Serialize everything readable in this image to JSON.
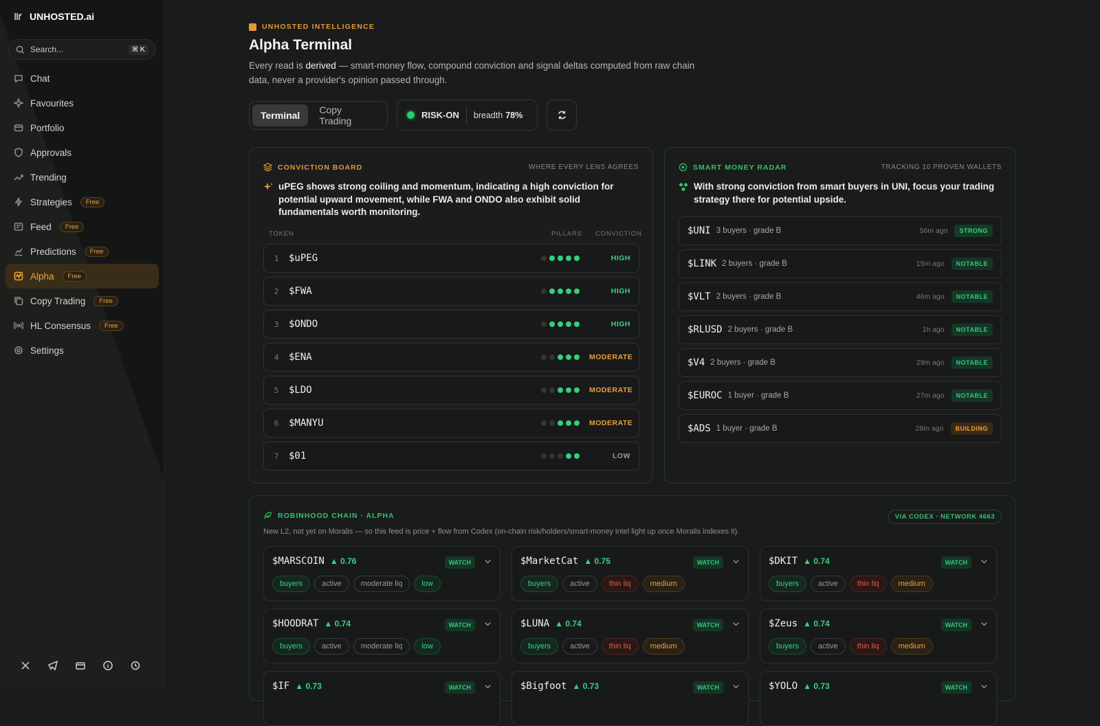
{
  "brand": {
    "name": "UNHOSTED.ai"
  },
  "search": {
    "placeholder": "Search...",
    "shortcut": "⌘ K"
  },
  "nav": [
    {
      "label": "Chat",
      "icon": "chat-icon"
    },
    {
      "label": "Favourites",
      "icon": "sparkle-icon"
    },
    {
      "label": "Portfolio",
      "icon": "wallet-icon"
    },
    {
      "label": "Approvals",
      "icon": "shield-icon"
    },
    {
      "label": "Trending",
      "icon": "trending-icon"
    },
    {
      "label": "Strategies",
      "icon": "bolt-icon",
      "badge": "Free"
    },
    {
      "label": "Feed",
      "icon": "feed-icon",
      "badge": "Free"
    },
    {
      "label": "Predictions",
      "icon": "chart-icon",
      "badge": "Free"
    },
    {
      "label": "Alpha",
      "icon": "alpha-icon",
      "badge": "Free",
      "active": true
    },
    {
      "label": "Copy Trading",
      "icon": "copy-icon",
      "badge": "Free"
    },
    {
      "label": "HL Consensus",
      "icon": "radio-icon",
      "badge": "Free"
    },
    {
      "label": "Settings",
      "icon": "gear-icon"
    }
  ],
  "footer_icons": [
    "x-icon",
    "telegram-icon",
    "wallet-icon",
    "info-icon",
    "history-icon"
  ],
  "header": {
    "eyebrow": "UNHOSTED INTELLIGENCE",
    "title": "Alpha Terminal",
    "sub_pre": "Every read is ",
    "sub_bold": "derived",
    "sub_post": " — smart-money flow, compound conviction and signal deltas computed from raw chain data, never a provider's opinion passed through."
  },
  "tabs": [
    "Terminal",
    "Copy Trading"
  ],
  "regime": {
    "label": "RISK-ON",
    "breadth_label": "breadth",
    "breadth_value": "78%"
  },
  "conviction": {
    "title": "CONVICTION BOARD",
    "right": "WHERE EVERY LENS AGREES",
    "summary": "uPEG shows strong coiling and momentum, indicating a high conviction for potential upward movement, while FWA and ONDO also exhibit solid fundamentals worth monitoring.",
    "col_token": "TOKEN",
    "col_pillars": "PILLARS",
    "col_conviction": "CONVICTION",
    "rows": [
      {
        "rank": "1",
        "token": "$uPEG",
        "pillars": 4,
        "level": "HIGH"
      },
      {
        "rank": "2",
        "token": "$FWA",
        "pillars": 4,
        "level": "HIGH"
      },
      {
        "rank": "3",
        "token": "$ONDO",
        "pillars": 4,
        "level": "HIGH"
      },
      {
        "rank": "4",
        "token": "$ENA",
        "pillars": 3,
        "level": "MODERATE"
      },
      {
        "rank": "5",
        "token": "$LDO",
        "pillars": 3,
        "level": "MODERATE"
      },
      {
        "rank": "6",
        "token": "$MANYU",
        "pillars": 3,
        "level": "MODERATE"
      },
      {
        "rank": "7",
        "token": "$01",
        "pillars": 2,
        "level": "LOW"
      }
    ],
    "pillar_total": 5
  },
  "radar": {
    "title": "SMART MONEY RADAR",
    "right": "TRACKING 10 PROVEN WALLETS",
    "summary": "With strong conviction from smart buyers in UNI, focus your trading strategy there for potential upside.",
    "rows": [
      {
        "token": "$UNI",
        "meta": "3 buyers · grade B",
        "ago": "56m ago",
        "tag": "STRONG"
      },
      {
        "token": "$LINK",
        "meta": "2 buyers · grade B",
        "ago": "15m ago",
        "tag": "NOTABLE"
      },
      {
        "token": "$VLT",
        "meta": "2 buyers · grade B",
        "ago": "46m ago",
        "tag": "NOTABLE"
      },
      {
        "token": "$RLUSD",
        "meta": "2 buyers · grade B",
        "ago": "1h ago",
        "tag": "NOTABLE"
      },
      {
        "token": "$V4",
        "meta": "2 buyers · grade B",
        "ago": "29m ago",
        "tag": "NOTABLE"
      },
      {
        "token": "$EUROC",
        "meta": "1 buyer · grade B",
        "ago": "27m ago",
        "tag": "NOTABLE"
      },
      {
        "token": "$ADS",
        "meta": "1 buyer · grade B",
        "ago": "28m ago",
        "tag": "BUILDING"
      }
    ]
  },
  "chain": {
    "title": "ROBINHOOD CHAIN · ALPHA",
    "via": "VIA CODEX · NETWORK 4663",
    "sub": "New L2, not yet on Moralis — so this feed is price + flow from Codex (on-chain risk/holders/smart-money intel light up once Moralis indexes it).",
    "cards": [
      {
        "token": "$MARSCOIN",
        "score": "▲ 0.76",
        "action": "WATCH",
        "chips": [
          [
            "buyers",
            "g"
          ],
          [
            "active",
            ""
          ],
          [
            "moderate liq",
            ""
          ],
          [
            "low",
            "g"
          ]
        ]
      },
      {
        "token": "$MarketCat",
        "score": "▲ 0.75",
        "action": "WATCH",
        "chips": [
          [
            "buyers",
            "g"
          ],
          [
            "active",
            ""
          ],
          [
            "thin liq",
            "r"
          ],
          [
            "medium",
            "o"
          ]
        ]
      },
      {
        "token": "$DKIT",
        "score": "▲ 0.74",
        "action": "WATCH",
        "chips": [
          [
            "buyers",
            "g"
          ],
          [
            "active",
            ""
          ],
          [
            "thin liq",
            "r"
          ],
          [
            "medium",
            "o"
          ]
        ]
      },
      {
        "token": "$HOODRAT",
        "score": "▲ 0.74",
        "action": "WATCH",
        "chips": [
          [
            "buyers",
            "g"
          ],
          [
            "active",
            ""
          ],
          [
            "moderate liq",
            ""
          ],
          [
            "low",
            "g"
          ]
        ]
      },
      {
        "token": "$LUNA",
        "score": "▲ 0.74",
        "action": "WATCH",
        "chips": [
          [
            "buyers",
            "g"
          ],
          [
            "active",
            ""
          ],
          [
            "thin liq",
            "r"
          ],
          [
            "medium",
            "o"
          ]
        ]
      },
      {
        "token": "$Zeus",
        "score": "▲ 0.74",
        "action": "WATCH",
        "chips": [
          [
            "buyers",
            "g"
          ],
          [
            "active",
            ""
          ],
          [
            "thin liq",
            "r"
          ],
          [
            "medium",
            "o"
          ]
        ]
      },
      {
        "token": "$IF",
        "score": "▲ 0.73",
        "action": "WATCH",
        "chips": []
      },
      {
        "token": "$Bigfoot",
        "score": "▲ 0.73",
        "action": "WATCH",
        "chips": []
      },
      {
        "token": "$YOLO",
        "score": "▲ 0.73",
        "action": "WATCH",
        "chips": []
      }
    ]
  },
  "colors": {
    "accent": "#f0a33a",
    "green": "#34d17d",
    "red": "#e05a4f"
  }
}
